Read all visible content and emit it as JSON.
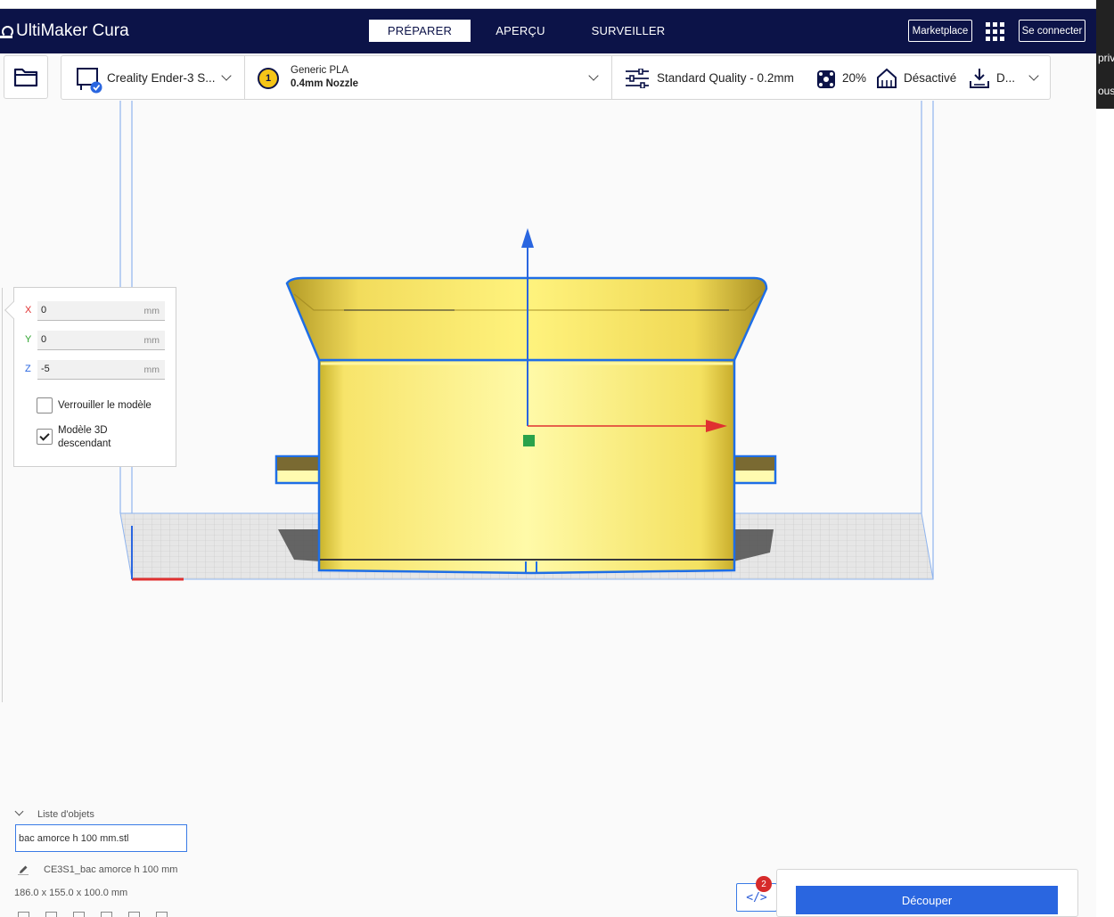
{
  "app": {
    "title": "UltiMaker Cura"
  },
  "header": {
    "tabs": [
      {
        "label": "PRÉPARER",
        "active": true
      },
      {
        "label": "APERÇU",
        "active": false
      },
      {
        "label": "SURVEILLER",
        "active": false
      }
    ],
    "marketplace_label": "Marketplace",
    "signin_label": "Se connecter"
  },
  "toolbar": {
    "printer_name": "Creality Ender-3 S...",
    "extruder_number": "1",
    "material_name": "Generic PLA",
    "nozzle_label": "0.4mm Nozzle",
    "quality_label": "Standard Quality - 0.2mm",
    "infill_value": "20%",
    "support_label": "Désactivé",
    "adhesion_label": "D..."
  },
  "move_panel": {
    "x": {
      "axis": "X",
      "value": "0",
      "unit": "mm",
      "color": "#e03030"
    },
    "y": {
      "axis": "Y",
      "value": "0",
      "unit": "mm",
      "color": "#2aa22a"
    },
    "z": {
      "axis": "Z",
      "value": "-5",
      "unit": "mm",
      "color": "#2a66e0"
    },
    "lock_model": {
      "label": "Verrouiller le modèle",
      "checked": false
    },
    "drop_down": {
      "label_line1": "Modèle 3D",
      "label_line2": "descendant",
      "checked": true
    }
  },
  "object_list": {
    "header": "Liste d'objets",
    "selected_object": "bac amorce h 100 mm.stl",
    "job_name": "CE3S1_bac amorce h 100 mm",
    "dimensions": "186.0 x 155.0 x 100.0 mm"
  },
  "slice": {
    "badge_count": "2",
    "code_icon": "</>",
    "slice_label": "Découper"
  },
  "background_window": {
    "text1": "priv",
    "text2": "ous"
  },
  "colors": {
    "header_bg": "#0c1348",
    "accent": "#2a66e0",
    "model_yellow": "#fff380",
    "selection_outline": "#1e6ee6"
  }
}
